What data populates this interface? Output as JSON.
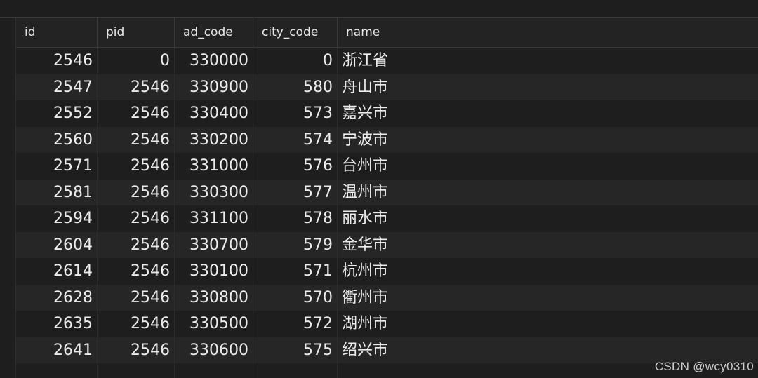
{
  "table": {
    "columns": [
      {
        "key": "id",
        "label": "id"
      },
      {
        "key": "pid",
        "label": "pid"
      },
      {
        "key": "ad_code",
        "label": "ad_code"
      },
      {
        "key": "city_code",
        "label": "city_code"
      },
      {
        "key": "name",
        "label": "name"
      }
    ],
    "rows": [
      {
        "id": "2546",
        "pid": "0",
        "ad_code": "330000",
        "city_code": "0",
        "name": "浙江省"
      },
      {
        "id": "2547",
        "pid": "2546",
        "ad_code": "330900",
        "city_code": "580",
        "name": "舟山市"
      },
      {
        "id": "2552",
        "pid": "2546",
        "ad_code": "330400",
        "city_code": "573",
        "name": "嘉兴市"
      },
      {
        "id": "2560",
        "pid": "2546",
        "ad_code": "330200",
        "city_code": "574",
        "name": "宁波市"
      },
      {
        "id": "2571",
        "pid": "2546",
        "ad_code": "331000",
        "city_code": "576",
        "name": "台州市"
      },
      {
        "id": "2581",
        "pid": "2546",
        "ad_code": "330300",
        "city_code": "577",
        "name": "温州市"
      },
      {
        "id": "2594",
        "pid": "2546",
        "ad_code": "331100",
        "city_code": "578",
        "name": "丽水市"
      },
      {
        "id": "2604",
        "pid": "2546",
        "ad_code": "330700",
        "city_code": "579",
        "name": "金华市"
      },
      {
        "id": "2614",
        "pid": "2546",
        "ad_code": "330100",
        "city_code": "571",
        "name": "杭州市"
      },
      {
        "id": "2628",
        "pid": "2546",
        "ad_code": "330800",
        "city_code": "570",
        "name": "衢州市"
      },
      {
        "id": "2635",
        "pid": "2546",
        "ad_code": "330500",
        "city_code": "572",
        "name": "湖州市"
      },
      {
        "id": "2641",
        "pid": "2546",
        "ad_code": "330600",
        "city_code": "575",
        "name": "绍兴市"
      }
    ]
  },
  "watermark": "CSDN @wcy0310"
}
